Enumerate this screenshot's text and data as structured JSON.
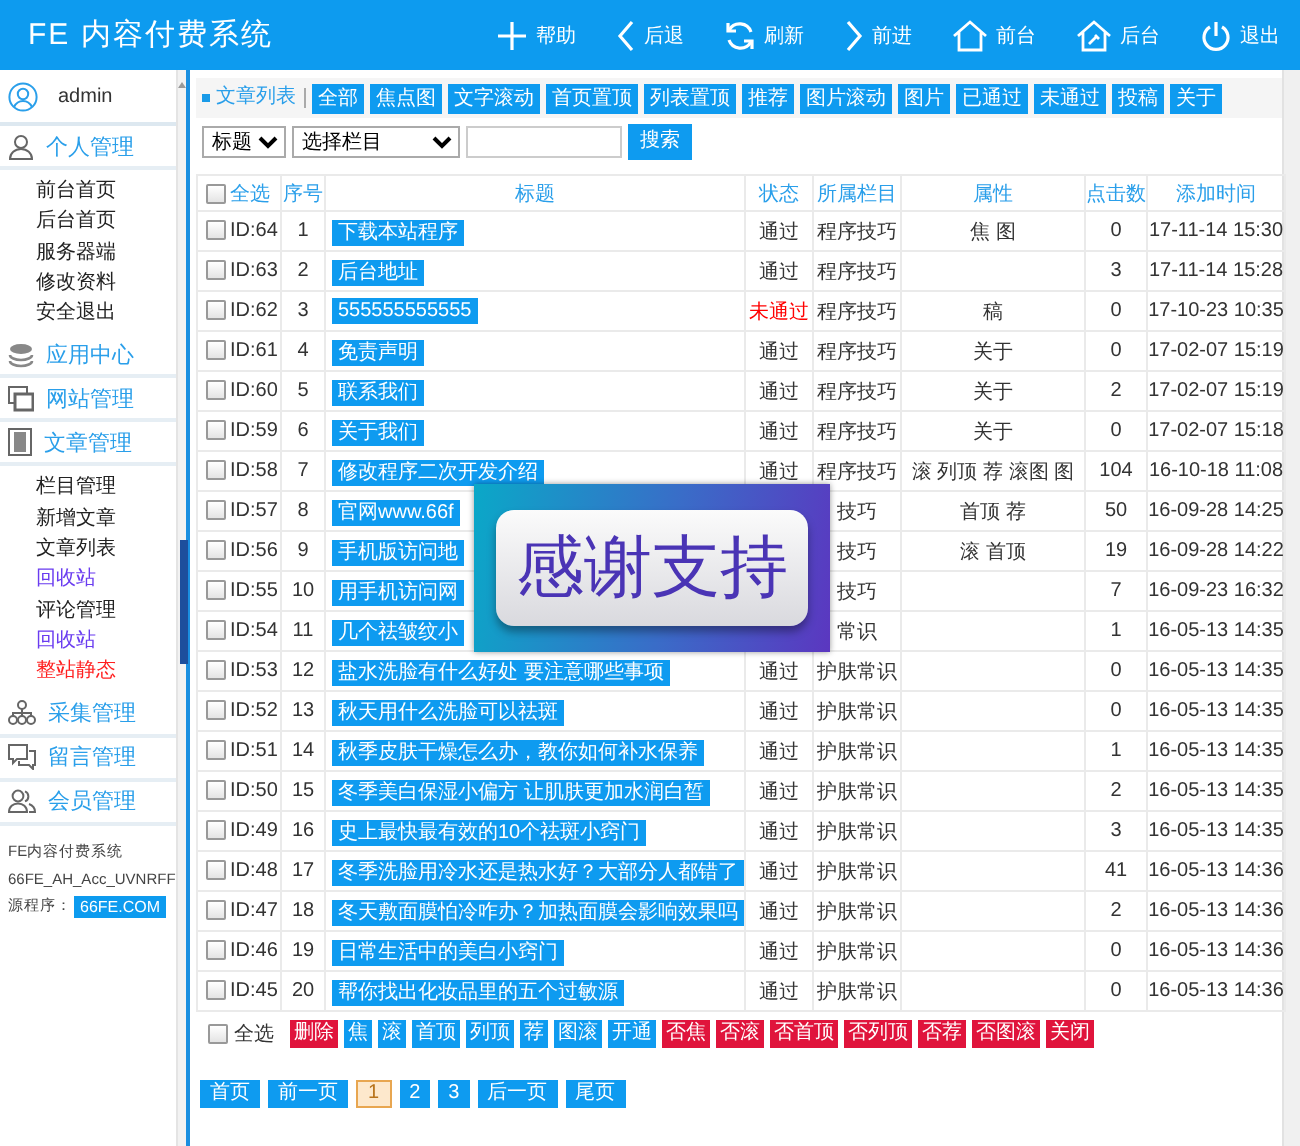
{
  "header": {
    "title": "FE 内容付费系统",
    "nav": [
      {
        "kind": "plus",
        "label": "帮助"
      },
      {
        "kind": "back",
        "label": "后退"
      },
      {
        "kind": "refresh",
        "label": "刷新"
      },
      {
        "kind": "forward",
        "label": "前进"
      },
      {
        "kind": "home",
        "label": "前台"
      },
      {
        "kind": "admin-home",
        "label": "后台"
      },
      {
        "kind": "power",
        "label": "退出"
      }
    ]
  },
  "sidebar": {
    "user": "admin",
    "groups": [
      {
        "kind": "user",
        "label": "个人管理",
        "items": [
          {
            "label": "前台首页"
          },
          {
            "label": "后台首页"
          },
          {
            "label": "服务器端"
          },
          {
            "label": "修改资料"
          },
          {
            "label": "安全退出"
          }
        ]
      },
      {
        "kind": "layers",
        "label": "应用中心"
      },
      {
        "kind": "windows",
        "label": "网站管理"
      },
      {
        "kind": "document",
        "label": "文章管理",
        "items": [
          {
            "label": "栏目管理"
          },
          {
            "label": "新增文章"
          },
          {
            "label": "文章列表"
          },
          {
            "label": "回收站",
            "color": "#6a3cf0"
          },
          {
            "label": "评论管理"
          },
          {
            "label": "回收站",
            "color": "#6a3cf0"
          },
          {
            "label": "整站静态",
            "color": "#ff2020"
          }
        ]
      },
      {
        "kind": "sitemap",
        "label": "采集管理"
      },
      {
        "kind": "chat",
        "label": "留言管理"
      },
      {
        "kind": "users",
        "label": "会员管理"
      }
    ],
    "footer": {
      "lines": [
        "FE内容付费系统",
        "66FE_AH_Acc_UVNRFF"
      ],
      "source_label": "源程序：",
      "source_badge": "66FE.COM"
    }
  },
  "toolbar": {
    "label": "文章列表",
    "filters": [
      "全部",
      "焦点图",
      "文字滚动",
      "首页置顶",
      "列表置顶",
      "推荐",
      "图片滚动",
      "图片",
      "已通过",
      "未通过",
      "投稿",
      "关于"
    ]
  },
  "search": {
    "field_select": "标题",
    "category_select": "选择栏目",
    "button": "搜索"
  },
  "table": {
    "select_all": {
      "label": "全选",
      "checked": false
    },
    "columns": [
      "序号",
      "标题",
      "状态",
      "所属栏目",
      "属性",
      "点击数",
      "添加时间"
    ],
    "rows": [
      {
        "id": "ID:64",
        "no": "1",
        "title": "下载本站程序",
        "status": "通过",
        "approved": true,
        "category": "程序技巧",
        "attrs": "焦 图",
        "clicks": "0",
        "time": "17-11-14 15:30",
        "checked": false
      },
      {
        "id": "ID:63",
        "no": "2",
        "title": "后台地址",
        "status": "通过",
        "approved": true,
        "category": "程序技巧",
        "clicks": "3",
        "time": "17-11-14 15:28",
        "checked": false
      },
      {
        "id": "ID:62",
        "no": "3",
        "title": "555555555555",
        "status": "未通过",
        "approved": false,
        "category": "程序技巧",
        "attrs": "稿",
        "clicks": "0",
        "time": "17-10-23 10:35",
        "checked": false
      },
      {
        "id": "ID:61",
        "no": "4",
        "title": "免责声明",
        "status": "通过",
        "approved": true,
        "category": "程序技巧",
        "attrs": "关于",
        "clicks": "0",
        "time": "17-02-07 15:19",
        "checked": false
      },
      {
        "id": "ID:60",
        "no": "5",
        "title": "联系我们",
        "status": "通过",
        "approved": true,
        "category": "程序技巧",
        "attrs": "关于",
        "clicks": "2",
        "time": "17-02-07 15:19",
        "checked": false
      },
      {
        "id": "ID:59",
        "no": "6",
        "title": "关于我们",
        "status": "通过",
        "approved": true,
        "category": "程序技巧",
        "attrs": "关于",
        "clicks": "0",
        "time": "17-02-07 15:18",
        "checked": false
      },
      {
        "id": "ID:58",
        "no": "7",
        "title": "修改程序二次开发介绍",
        "status": "通过",
        "approved": true,
        "category": "程序技巧",
        "attrs": "滚 列顶 荐 滚图 图",
        "clicks": "104",
        "time": "16-10-18 11:08",
        "checked": false
      },
      {
        "id": "ID:57",
        "no": "8",
        "title": "官网www.66f",
        "category": "技巧",
        "attrs": "首顶 荐",
        "clicks": "50",
        "time": "16-09-28 14:25",
        "checked": false
      },
      {
        "id": "ID:56",
        "no": "9",
        "title": "手机版访问地",
        "category": "技巧",
        "attrs": "滚 首顶",
        "clicks": "19",
        "time": "16-09-28 14:22",
        "checked": false
      },
      {
        "id": "ID:55",
        "no": "10",
        "title": "用手机访问网",
        "category": "技巧",
        "clicks": "7",
        "time": "16-09-23 16:32",
        "checked": false
      },
      {
        "id": "ID:54",
        "no": "11",
        "title": "几个祛皱纹小",
        "category": "常识",
        "clicks": "1",
        "time": "16-05-13 14:35",
        "checked": false
      },
      {
        "id": "ID:53",
        "no": "12",
        "title": "盐水洗脸有什么好处 要注意哪些事项",
        "status": "通过",
        "approved": true,
        "category": "护肤常识",
        "clicks": "0",
        "time": "16-05-13 14:35",
        "checked": false
      },
      {
        "id": "ID:52",
        "no": "13",
        "title": "秋天用什么洗脸可以祛斑",
        "status": "通过",
        "approved": true,
        "category": "护肤常识",
        "clicks": "0",
        "time": "16-05-13 14:35",
        "checked": false
      },
      {
        "id": "ID:51",
        "no": "14",
        "title": "秋季皮肤干燥怎么办，教你如何补水保养",
        "status": "通过",
        "approved": true,
        "category": "护肤常识",
        "clicks": "1",
        "time": "16-05-13 14:35",
        "checked": false
      },
      {
        "id": "ID:50",
        "no": "15",
        "title": "冬季美白保湿小偏方 让肌肤更加水润白皙",
        "status": "通过",
        "approved": true,
        "category": "护肤常识",
        "clicks": "2",
        "time": "16-05-13 14:35",
        "checked": false
      },
      {
        "id": "ID:49",
        "no": "16",
        "title": "史上最快最有效的10个祛斑小窍门",
        "status": "通过",
        "approved": true,
        "category": "护肤常识",
        "clicks": "3",
        "time": "16-05-13 14:35",
        "checked": false
      },
      {
        "id": "ID:48",
        "no": "17",
        "title": "冬季洗脸用冷水还是热水好？大部分人都错了",
        "status": "通过",
        "approved": true,
        "category": "护肤常识",
        "clicks": "41",
        "time": "16-05-13 14:36",
        "checked": false
      },
      {
        "id": "ID:47",
        "no": "18",
        "title": "冬天敷面膜怕冷咋办？加热面膜会影响效果吗",
        "status": "通过",
        "approved": true,
        "category": "护肤常识",
        "clicks": "2",
        "time": "16-05-13 14:36",
        "checked": false
      },
      {
        "id": "ID:46",
        "no": "19",
        "title": "日常生活中的美白小窍门",
        "status": "通过",
        "approved": true,
        "category": "护肤常识",
        "clicks": "0",
        "time": "16-05-13 14:36",
        "checked": false
      },
      {
        "id": "ID:45",
        "no": "20",
        "title": "帮你找出化妆品里的五个过敏源",
        "status": "通过",
        "approved": true,
        "category": "护肤常识",
        "clicks": "0",
        "time": "16-05-13 14:36",
        "checked": false
      }
    ]
  },
  "bulk": {
    "select_all": {
      "label": "全选",
      "checked": false
    },
    "actions": [
      {
        "label": "删除",
        "kind": "danger"
      },
      {
        "label": "焦",
        "kind": "primary"
      },
      {
        "label": "滚",
        "kind": "primary"
      },
      {
        "label": "首顶",
        "kind": "primary"
      },
      {
        "label": "列顶",
        "kind": "primary"
      },
      {
        "label": "荐",
        "kind": "primary"
      },
      {
        "label": "图滚",
        "kind": "primary"
      },
      {
        "label": "开通",
        "kind": "primary"
      },
      {
        "label": "否焦",
        "kind": "danger"
      },
      {
        "label": "否滚",
        "kind": "danger"
      },
      {
        "label": "否首顶",
        "kind": "danger"
      },
      {
        "label": "否列顶",
        "kind": "danger"
      },
      {
        "label": "否荐",
        "kind": "danger"
      },
      {
        "label": "否图滚",
        "kind": "danger"
      },
      {
        "label": "关闭",
        "kind": "danger"
      }
    ]
  },
  "pagination": [
    {
      "label": "首页",
      "selected": false
    },
    {
      "label": "前一页",
      "selected": false
    },
    {
      "label": "1",
      "selected": true
    },
    {
      "label": "2",
      "selected": false
    },
    {
      "label": "3",
      "selected": false
    },
    {
      "label": "后一页",
      "selected": false
    },
    {
      "label": "尾页",
      "selected": false
    }
  ],
  "popup": {
    "text": "感谢支持"
  }
}
